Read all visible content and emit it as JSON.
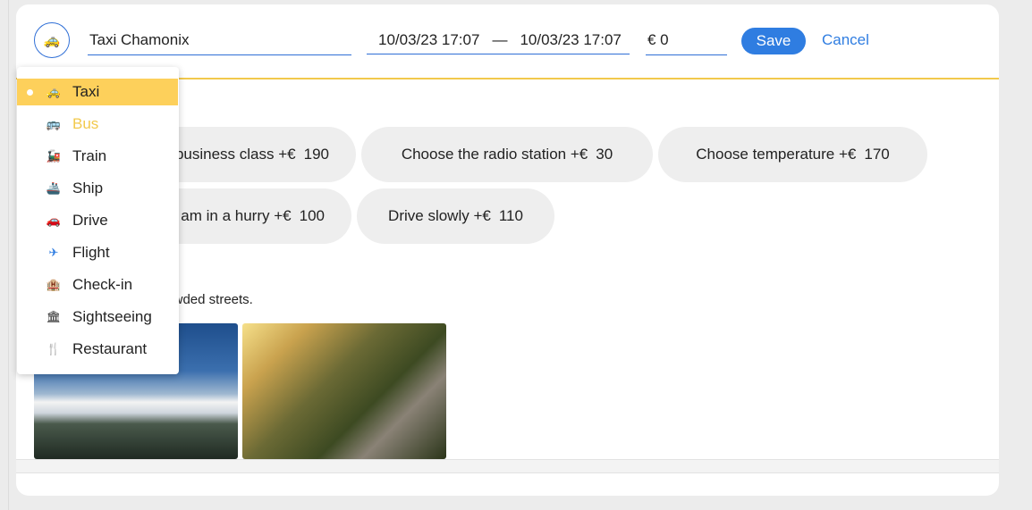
{
  "trip": {
    "category_icon": "taxi-icon",
    "category_glyph": "🚕",
    "title_value": "Taxi Chamonix",
    "start_datetime": "10/03/23 17:07",
    "date_separator": "—",
    "end_datetime": "10/03/23 17:07",
    "price_value": "€ 0",
    "save_label": "Save",
    "cancel_label": "Cancel"
  },
  "options": [
    {
      "label": "Choose business class +€",
      "price": "190"
    },
    {
      "label": "Choose the radio station +€",
      "price": "30"
    },
    {
      "label": "Choose temperature +€",
      "price": "170"
    },
    {
      "label": "I am in a hurry +€",
      "price": "100"
    },
    {
      "label": "Drive slowly +€",
      "price": "110"
    }
  ],
  "description": "A beautiful city, with crowded streets.",
  "photos": [
    {
      "subject": "snowy mountain range under blue sky"
    },
    {
      "subject": "waterfall over forested cliffs at sunrise"
    }
  ],
  "category_menu": {
    "selected": "Taxi",
    "items": [
      {
        "label": "Taxi",
        "icon": "taxi-icon",
        "glyph": "🚕"
      },
      {
        "label": "Bus",
        "icon": "bus-icon",
        "glyph": "🚌"
      },
      {
        "label": "Train",
        "icon": "train-icon",
        "glyph": "🚂"
      },
      {
        "label": "Ship",
        "icon": "ship-icon",
        "glyph": "🚢"
      },
      {
        "label": "Drive",
        "icon": "car-icon",
        "glyph": "🚗"
      },
      {
        "label": "Flight",
        "icon": "airplane-icon",
        "glyph": "✈"
      },
      {
        "label": "Check-in",
        "icon": "hotel-icon",
        "glyph": "🏨"
      },
      {
        "label": "Sightseeing",
        "icon": "museum-icon",
        "glyph": "🏛"
      },
      {
        "label": "Restaurant",
        "icon": "fork-knife-icon",
        "glyph": "🍴"
      }
    ]
  },
  "colors": {
    "accent": "#2f7de1",
    "highlight": "#fdd05b",
    "divider": "#f2c94c"
  }
}
